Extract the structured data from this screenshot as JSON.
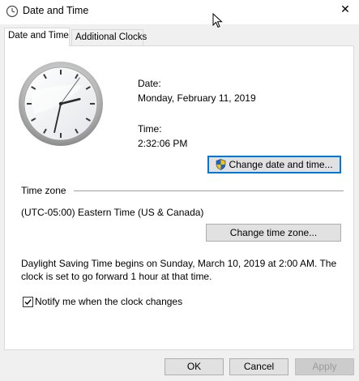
{
  "window": {
    "title": "Date and Time",
    "close_glyph": "✕"
  },
  "tabs": [
    {
      "label": "Date and Time",
      "active": true
    },
    {
      "label": "Additional Clocks",
      "active": false
    }
  ],
  "date_section": {
    "date_label": "Date:",
    "date_value": "Monday, February 11, 2019",
    "time_label": "Time:",
    "time_value": "2:32:06 PM",
    "change_button": "Change date and time..."
  },
  "clock": {
    "hours": 2,
    "minutes": 32,
    "seconds": 6
  },
  "timezone_section": {
    "heading": "Time zone",
    "value": "(UTC-05:00) Eastern Time (US & Canada)",
    "change_button": "Change time zone..."
  },
  "dst": {
    "line1": "Daylight Saving Time begins on Sunday, March 10, 2019 at 2:00 AM. The",
    "line2": "clock is set to go forward 1 hour at that time."
  },
  "notify": {
    "label": "Notify me when the clock changes",
    "checked": true
  },
  "footer": {
    "ok": "OK",
    "cancel": "Cancel",
    "apply": "Apply"
  },
  "colors": {
    "accent": "#0078d7",
    "shield_blue": "#1f64c8",
    "shield_gold": "#f5c400"
  },
  "icons": [
    "clock-app-icon",
    "close-icon",
    "mouse-cursor-icon",
    "uac-shield-icon",
    "checkmark-icon"
  ]
}
